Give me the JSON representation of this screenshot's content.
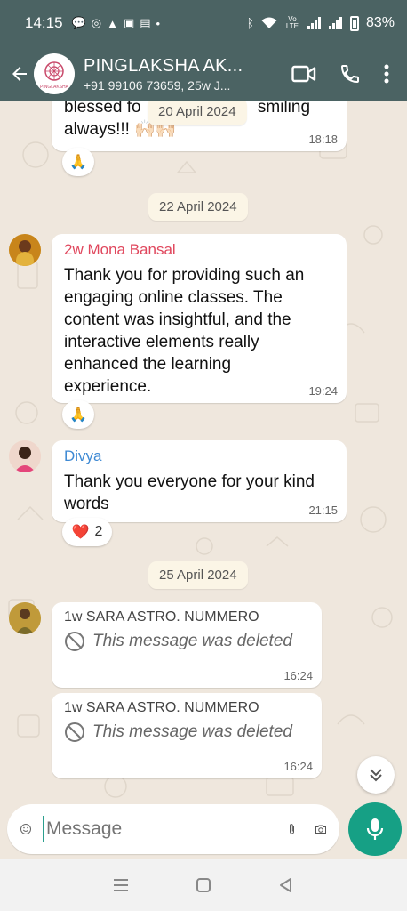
{
  "status": {
    "time": "14:15",
    "battery": "83%",
    "volte": "Vo LTE"
  },
  "header": {
    "title": "PINGLAKSHA AK...",
    "subtitle": "+91 99106 73659, 25w J...",
    "logo_text": "PINGLAKSHA"
  },
  "chat": {
    "first_msg": {
      "text_line1": "blessed fo",
      "text_tail": "smiling",
      "text_line2": "always!!! 🙌🏻🙌🏻",
      "time": "18:18",
      "reaction": "🙏"
    },
    "floating_date": "20 April 2024",
    "date1": "22 April 2024",
    "msg2": {
      "sender": "2w Mona Bansal",
      "sender_color": "#e0475d",
      "text": "Thank you for providing such an engaging online classes. The content was insightful, and the interactive elements really enhanced the learning experience.",
      "time": "19:24",
      "reaction": "🙏"
    },
    "msg3": {
      "sender": "Divya",
      "sender_color": "#3f8ad4",
      "text": "Thank you everyone for your kind words",
      "time": "21:15",
      "reaction": "❤️",
      "reaction_count": "2"
    },
    "date2": "25 April 2024",
    "msg4": {
      "sender": "1w SARA ASTRO. NUMMERO",
      "text": "This message was deleted",
      "time": "16:24"
    },
    "msg5": {
      "sender": "1w SARA ASTRO. NUMMERO",
      "text": "This message was deleted",
      "time": "16:24"
    }
  },
  "input": {
    "placeholder": "Message"
  },
  "colors": {
    "header": "#4b6363",
    "accent": "#16a085",
    "chat_bg": "#efe7dd"
  }
}
